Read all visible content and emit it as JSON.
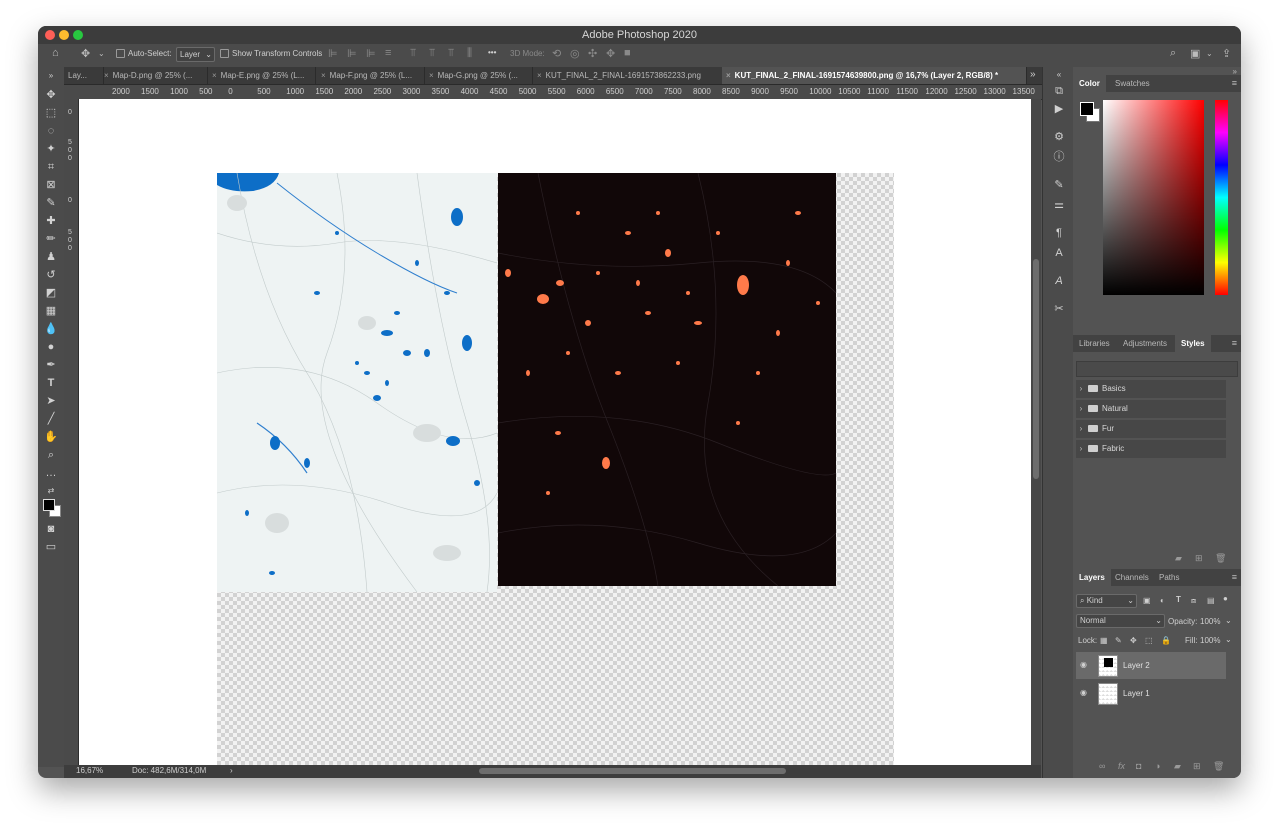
{
  "window": {
    "title": "Adobe Photoshop 2020"
  },
  "options_bar": {
    "auto_select_label": "Auto-Select:",
    "auto_select_value": "Layer",
    "transform_label": "Show Transform Controls",
    "mode_3d_label": "3D Mode:",
    "more_label": "•••"
  },
  "tabs": [
    {
      "label": "Lay..."
    },
    {
      "label": "Map-D.png @ 25% (..."
    },
    {
      "label": "Map-E.png @ 25% (L..."
    },
    {
      "label": "Map-F.png @ 25% (L..."
    },
    {
      "label": "Map-G.png @ 25% (..."
    },
    {
      "label": "KUT_FINAL_2_FINAL-1691573862233.png"
    },
    {
      "label": "KUT_FINAL_2_FINAL-1691574639800.png @ 16,7% (Layer 2, RGB/8) *"
    }
  ],
  "ruler": {
    "h_ticks": [
      "2000",
      "1500",
      "1000",
      "500",
      "0",
      "500",
      "1000",
      "1500",
      "2000",
      "2500",
      "3000",
      "3500",
      "4000",
      "4500",
      "5000",
      "5500",
      "6000",
      "6500",
      "7000",
      "7500",
      "8000",
      "8500",
      "9000",
      "9500",
      "10000",
      "10500",
      "11000",
      "11500",
      "12000",
      "12500",
      "13000",
      "13500"
    ]
  },
  "status": {
    "zoom": "16,67%",
    "doc": "Doc: 482,6M/314,0M",
    "arrow": "›"
  },
  "color_panel": {
    "tab_color": "Color",
    "tab_swatches": "Swatches"
  },
  "styles_panel": {
    "tab_libraries": "Libraries",
    "tab_adjustments": "Adjustments",
    "tab_styles": "Styles",
    "folders": [
      {
        "label": "Basics"
      },
      {
        "label": "Natural"
      },
      {
        "label": "Fur"
      },
      {
        "label": "Fabric"
      }
    ]
  },
  "layers_panel": {
    "tab_layers": "Layers",
    "tab_channels": "Channels",
    "tab_paths": "Paths",
    "kind_label": "Kind",
    "blend_mode": "Normal",
    "opacity_label": "Opacity:",
    "opacity_value": "100%",
    "lock_label": "Lock:",
    "fill_label": "Fill:",
    "fill_value": "100%",
    "layers": [
      {
        "name": "Layer 2",
        "selected": true
      },
      {
        "name": "Layer 1",
        "selected": false
      }
    ]
  },
  "icons": [
    "home-icon",
    "move-icon",
    "marquee-icon",
    "lasso-icon",
    "magic-wand-icon",
    "crop-icon",
    "frame-icon",
    "eyedropper-icon",
    "healing-icon",
    "brush-icon",
    "stamp-icon",
    "history-brush-icon",
    "eraser-icon",
    "gradient-icon",
    "blur-icon",
    "dodge-icon",
    "pen-icon",
    "type-icon",
    "path-select-icon",
    "line-icon",
    "hand-icon",
    "zoom-icon",
    "search-icon",
    "eye-icon",
    "folder-icon",
    "trash-icon"
  ],
  "colors": {
    "accent_blue": "#0d6ec7",
    "accent_orange": "#ff7a4a",
    "panel_bg": "#535353"
  }
}
